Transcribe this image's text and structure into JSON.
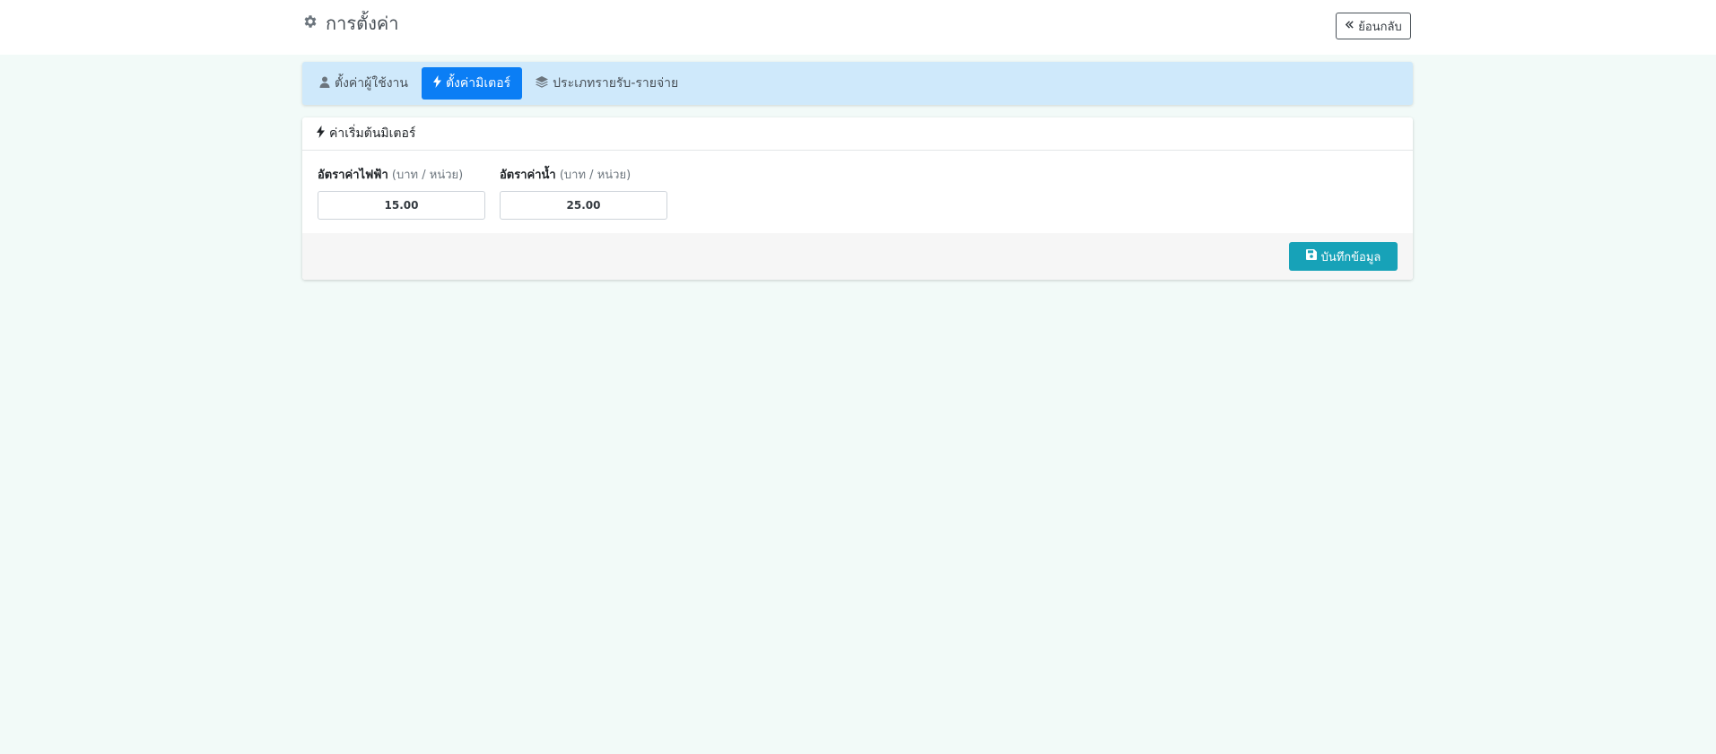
{
  "header": {
    "title": "การตั้งค่า",
    "title_icon": "gear-icon",
    "back_label": "ย้อนกลับ",
    "back_icon": "double-chevron-left-icon"
  },
  "tabs": [
    {
      "label": "ตั้งค่าผู้ใช้งาน",
      "icon": "user-icon",
      "active": false
    },
    {
      "label": "ตั้งค่ามิเตอร์",
      "icon": "bolt-icon",
      "active": true
    },
    {
      "label": "ประเภทรายรับ-รายจ่าย",
      "icon": "layers-icon",
      "active": false
    }
  ],
  "card": {
    "title": "ค่าเริ่มต้นมิเตอร์",
    "title_icon": "bolt-icon",
    "fields": [
      {
        "label": "อัตราค่าไฟฟ้า",
        "unit": "(บาท / หน่วย)",
        "value": "15.00"
      },
      {
        "label": "อัตราค่าน้ำ",
        "unit": "(บาท / หน่วย)",
        "value": "25.00"
      }
    ],
    "save_label": "บันทึกข้อมูล",
    "save_icon": "floppy-disk-icon"
  },
  "colors": {
    "page_background": "#f2faf8",
    "tabs_background": "#cfe9fb",
    "active_tab": "#0b7ef5",
    "save_button": "#17a2b8"
  }
}
